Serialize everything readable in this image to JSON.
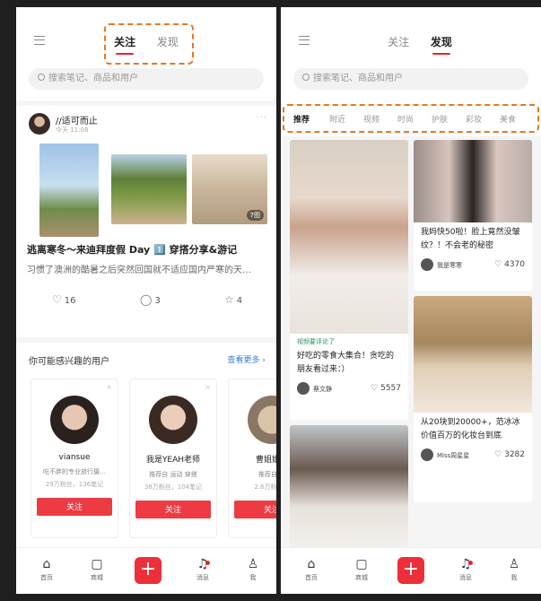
{
  "left": {
    "tabs": [
      "关注",
      "发现"
    ],
    "active_tab": "关注",
    "search_placeholder": "搜索笔记、商品和用户",
    "post": {
      "user": "//适可而止",
      "time": "今天 11:08",
      "photo_count": "7图",
      "title": "逃离寒冬～来迪拜度假 Day 1️⃣ 穿搭分享&游记",
      "body": "习惯了澳洲的酷暑之后突然回国就不适应国内严寒的天…",
      "likes": "16",
      "comments": "3",
      "stars": "4"
    },
    "recommend": {
      "title": "你可能感兴趣的用户",
      "more": "查看更多 ›",
      "users": [
        {
          "name": "viansue",
          "desc": "吃不胖的专业旅行摄…",
          "stats": "29万粉丝，136笔记",
          "button": "关注"
        },
        {
          "name": "我是YEAH老师",
          "desc": "推荐自 运动 穿搭",
          "stats": "38万粉丝，104笔记",
          "button": "关注"
        },
        {
          "name": "曹姐姐的",
          "desc": "推荐自 穿",
          "stats": "2.6万粉丝，",
          "button": "关注"
        }
      ]
    },
    "bottom_nav": [
      "首页",
      "商城",
      "+",
      "消息",
      "我"
    ]
  },
  "right": {
    "tabs": [
      "关注",
      "发现"
    ],
    "active_tab": "发现",
    "search_placeholder": "搜索笔记、商品和用户",
    "categories": [
      "推荐",
      "附近",
      "视频",
      "时尚",
      "护肤",
      "彩妆",
      "美食"
    ],
    "feed": [
      {
        "tag": "视频要评论了",
        "title": "好吃的零食大集合！贪吃的朋友看过来：）",
        "user": "蔡文静",
        "likes": "5557"
      },
      {
        "title": "我妈快50啦！脸上竟然没皱纹？！不会老的秘密",
        "user": "我是寒寒",
        "likes": "4370"
      },
      {
        "title": "从20块到20000+，范冰冰价值百万的化妆台到底",
        "user": "Miss周星星",
        "likes": "3282"
      }
    ],
    "bottom_nav": [
      "首页",
      "商城",
      "+",
      "消息",
      "我"
    ]
  },
  "colors": {
    "accent": "#ed2f3a",
    "link": "#3d7bd9",
    "highlight": "#e87722"
  }
}
